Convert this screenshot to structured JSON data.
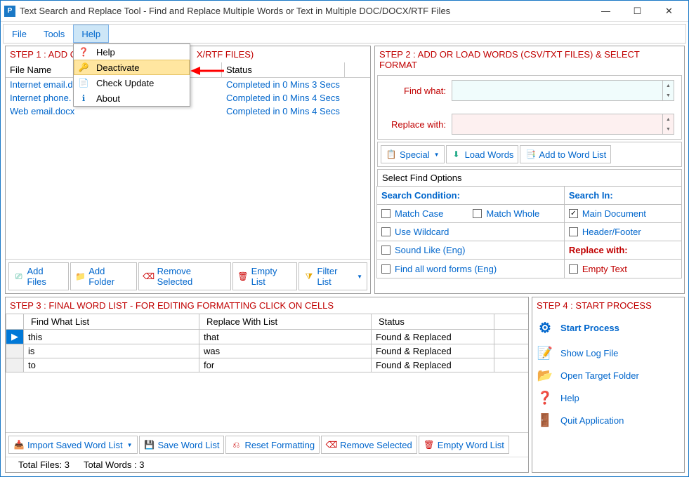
{
  "titlebar": {
    "title": "Text Search and Replace Tool  - Find and Replace Multiple Words or Text  in Multiple DOC/DOCX/RTF Files"
  },
  "menus": {
    "file": "File",
    "tools": "Tools",
    "help": "Help"
  },
  "helpmenu": {
    "help": "Help",
    "deactivate": "Deactivate",
    "check": "Check Update",
    "about": "About"
  },
  "step1": {
    "title": "STEP 1 : ADD OR LOAD DOCUMENTS (DOC/DOCX/RTF FILES)",
    "title_vis": "STEP 1 : ADD O",
    "title_vis2": "X/RTF FILES)",
    "cols": {
      "file": "File Name",
      "status": "Status"
    },
    "rows": [
      {
        "file": "Internet email.d",
        "status": "Completed in 0 Mins 3 Secs"
      },
      {
        "file": "Internet phone.",
        "status": "Completed in 0 Mins 4 Secs"
      },
      {
        "file": "Web email.docx",
        "status": "Completed in 0 Mins 4 Secs"
      }
    ],
    "btns": {
      "add": "Add Files",
      "folder": "Add Folder",
      "remove": "Remove Selected",
      "empty": "Empty List",
      "filter": "Filter List"
    }
  },
  "step2": {
    "title": "STEP 2 : ADD OR LOAD WORDS (CSV/TXT FILES) & SELECT FORMAT",
    "find": "Find what:",
    "replace": "Replace with:",
    "btns": {
      "special": "Special",
      "load": "Load Words",
      "add": "Add to Word List"
    },
    "opts_title": "Select Find Options",
    "cond": "Search Condition:",
    "searchin": "Search In:",
    "matchcase": "Match Case",
    "matchwhole": "Match Whole",
    "wildcard": "Use Wildcard",
    "sound": "Sound Like (Eng)",
    "forms": "Find all word forms (Eng)",
    "maindoc": "Main Document",
    "hf": "Header/Footer",
    "replacewith": "Replace with:",
    "emptytext": "Empty Text"
  },
  "step3": {
    "title": "STEP 3 : FINAL WORD LIST - FOR EDITING FORMATTING CLICK ON CELLS",
    "cols": {
      "find": "Find What List",
      "replace": "Replace With List",
      "status": "Status"
    },
    "rows": [
      {
        "f": "this",
        "r": "that",
        "s": "Found & Replaced"
      },
      {
        "f": "is",
        "r": "was",
        "s": "Found & Replaced"
      },
      {
        "f": "to",
        "r": "for",
        "s": "Found & Replaced"
      }
    ],
    "btns": {
      "import": "Import Saved Word List",
      "save": "Save Word List",
      "reset": "Reset Formatting",
      "remove": "Remove Selected",
      "empty": "Empty Word List"
    },
    "footer": {
      "files": "Total Files: 3",
      "words": "Total Words : 3"
    }
  },
  "step4": {
    "title": "STEP 4 : START PROCESS",
    "start": "Start Process",
    "log": "Show Log File",
    "target": "Open Target Folder",
    "help": "Help",
    "quit": "Quit Application"
  }
}
